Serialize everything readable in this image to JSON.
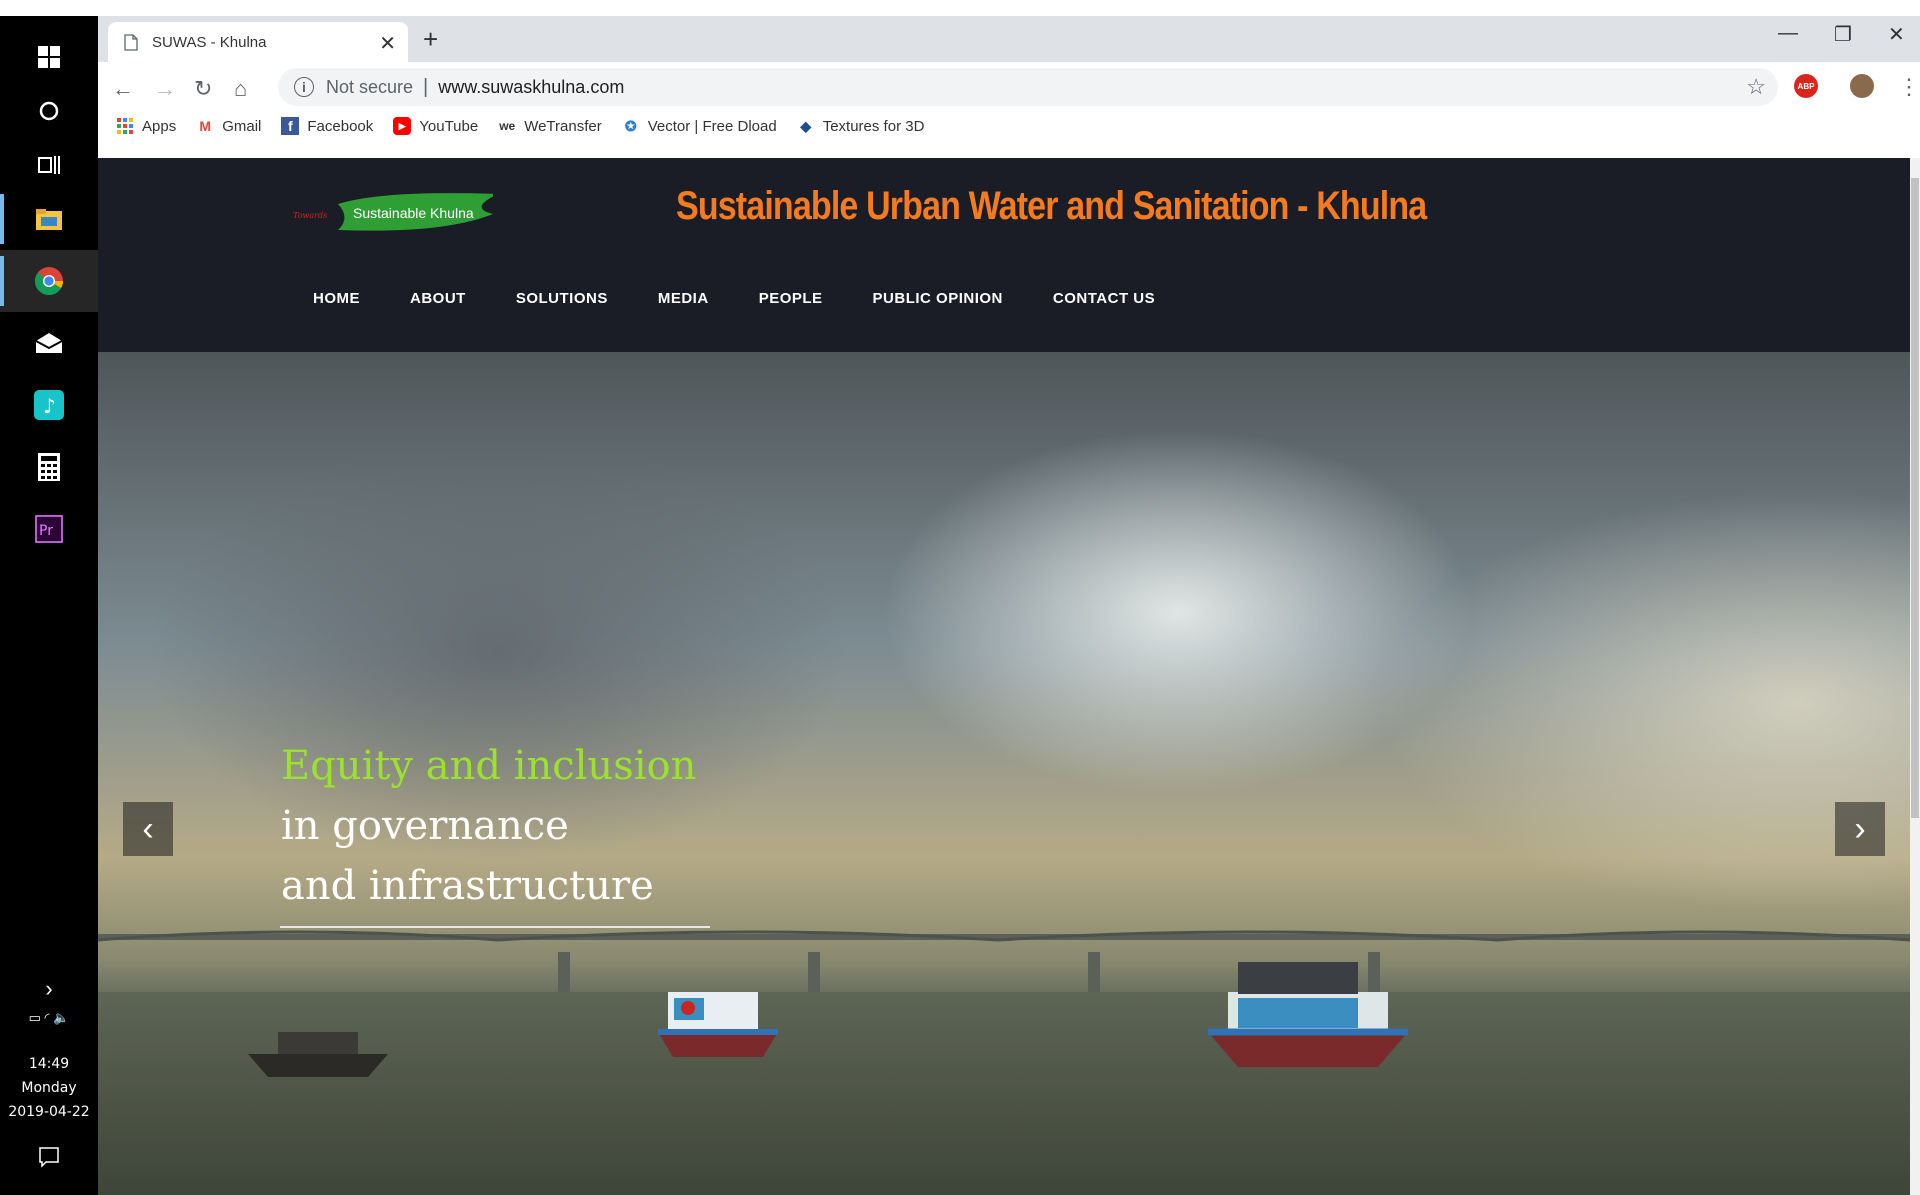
{
  "taskbar": {
    "time": "14:49",
    "day": "Monday",
    "date": "2019-04-22"
  },
  "browser": {
    "tab_title": "SUWAS - Khulna",
    "security_label": "Not secure",
    "url": "www.suwaskhulna.com",
    "bookmarks": [
      {
        "label": "Apps",
        "icon": "apps-grid-icon"
      },
      {
        "label": "Gmail",
        "icon": "gmail-icon"
      },
      {
        "label": "Facebook",
        "icon": "facebook-icon"
      },
      {
        "label": "YouTube",
        "icon": "youtube-icon"
      },
      {
        "label": "WeTransfer",
        "icon": "wetransfer-icon"
      },
      {
        "label": "Vector | Free Dload",
        "icon": "vector-icon"
      },
      {
        "label": "Textures for 3D",
        "icon": "textures-icon"
      }
    ]
  },
  "site": {
    "logo_text": "Sustainable Khulna",
    "title": "Sustainable Urban Water and Sanitation - Khulna",
    "nav": [
      "HOME",
      "ABOUT",
      "SOLUTIONS",
      "MEDIA",
      "PEOPLE",
      "PUBLIC OPINION",
      "CONTACT US"
    ],
    "hero": {
      "line1": "Equity and inclusion",
      "line2": "in governance",
      "line3": "and infrastructure"
    }
  },
  "colors": {
    "title_orange": "#f47b20",
    "header_bg": "#1b1d26",
    "caption_green": "#9be22d"
  }
}
